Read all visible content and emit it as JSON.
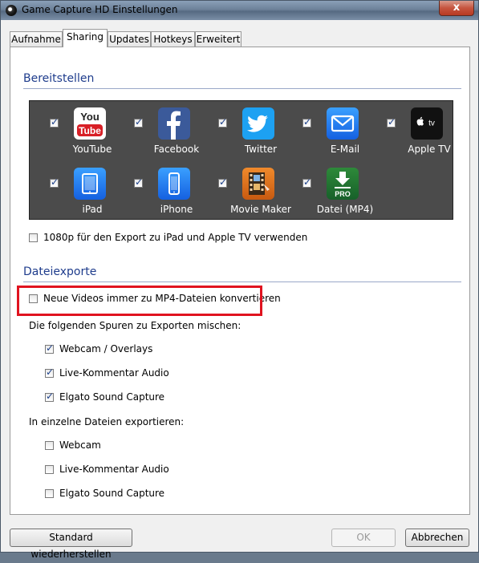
{
  "window": {
    "title": "Game Capture HD Einstellungen",
    "close_glyph": "x",
    "tabs": [
      {
        "label": "Aufnahme"
      },
      {
        "label": "Sharing"
      },
      {
        "label": "Updates"
      },
      {
        "label": "Hotkeys"
      },
      {
        "label": "Erweitert"
      }
    ],
    "active_tab": "Sharing"
  },
  "sharing": {
    "section_title": "Bereitstellen",
    "services": [
      {
        "label": "YouTube",
        "checked": true,
        "icon": "youtube-icon"
      },
      {
        "label": "Facebook",
        "checked": true,
        "icon": "facebook-icon"
      },
      {
        "label": "Twitter",
        "checked": true,
        "icon": "twitter-icon"
      },
      {
        "label": "E-Mail",
        "checked": true,
        "icon": "mail-icon"
      },
      {
        "label": "Apple TV",
        "checked": true,
        "icon": "appletv-icon"
      },
      {
        "label": "iPad",
        "checked": true,
        "icon": "ipad-icon"
      },
      {
        "label": "iPhone",
        "checked": true,
        "icon": "iphone-icon"
      },
      {
        "label": "Movie Maker",
        "checked": true,
        "icon": "moviemaker-icon"
      },
      {
        "label": "Datei (MP4)",
        "checked": true,
        "icon": "mp4-file-icon"
      }
    ],
    "appletv_icon_text": "tv",
    "mp4_icon_text": "PRO",
    "hd_option": {
      "label": "1080p für den Export zu iPad und Apple TV verwenden",
      "checked": false
    }
  },
  "exports": {
    "section_title": "Dateiexporte",
    "convert_option": {
      "label": "Neue Videos immer zu MP4-Dateien konvertieren",
      "checked": false
    },
    "mix_heading": "Die folgenden Spuren zu Exporten mischen:",
    "mix_tracks": [
      {
        "label": "Webcam / Overlays",
        "checked": true
      },
      {
        "label": "Live-Kommentar Audio",
        "checked": true
      },
      {
        "label": "Elgato Sound Capture",
        "checked": true
      }
    ],
    "separate_heading": "In einzelne Dateien exportieren:",
    "separate_tracks": [
      {
        "label": "Webcam",
        "checked": false
      },
      {
        "label": "Live-Kommentar Audio",
        "checked": false
      },
      {
        "label": "Elgato Sound Capture",
        "checked": false
      }
    ]
  },
  "footer": {
    "restore_label": "Standard wiederherstellen",
    "ok_label": "OK",
    "cancel_label": "Abbrechen",
    "ok_enabled": false
  },
  "colors": {
    "section_title": "#1e3c8c",
    "highlight_border": "#e0131f",
    "share_box_bg": "#4b4b4b"
  }
}
